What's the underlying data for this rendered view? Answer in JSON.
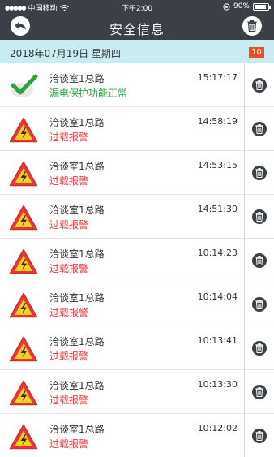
{
  "status_bar": {
    "carrier": "中国移动",
    "time": "下午2:00",
    "battery": "90%",
    "battery_level": 0.9
  },
  "header": {
    "title": "安全信息"
  },
  "date_bar": {
    "date": "2018年07月19日 星期四",
    "count": "10"
  },
  "colors": {
    "header_bg": "#3b3f46",
    "date_bar_bg": "#c9ecf2",
    "badge_bg": "#e8502a",
    "ok_green": "#29a33a",
    "alarm_red": "#e8383d"
  },
  "records": [
    {
      "name": "洽谈室1总路",
      "time": "15:17:17",
      "status": "漏电保护功能正常",
      "type": "ok"
    },
    {
      "name": "洽谈室1总路",
      "time": "14:58:19",
      "status": "过载报警",
      "type": "alarm"
    },
    {
      "name": "洽谈室1总路",
      "time": "14:53:15",
      "status": "过载报警",
      "type": "alarm"
    },
    {
      "name": "洽谈室1总路",
      "time": "14:51:30",
      "status": "过载报警",
      "type": "alarm"
    },
    {
      "name": "洽谈室1总路",
      "time": "10:14:23",
      "status": "过载报警",
      "type": "alarm"
    },
    {
      "name": "洽谈室1总路",
      "time": "10:14:04",
      "status": "过载报警",
      "type": "alarm"
    },
    {
      "name": "洽谈室1总路",
      "time": "10:13:41",
      "status": "过载报警",
      "type": "alarm"
    },
    {
      "name": "洽谈室1总路",
      "time": "10:13:30",
      "status": "过载报警",
      "type": "alarm"
    },
    {
      "name": "洽谈室1总路",
      "time": "10:12:02",
      "status": "过载报警",
      "type": "alarm"
    }
  ]
}
